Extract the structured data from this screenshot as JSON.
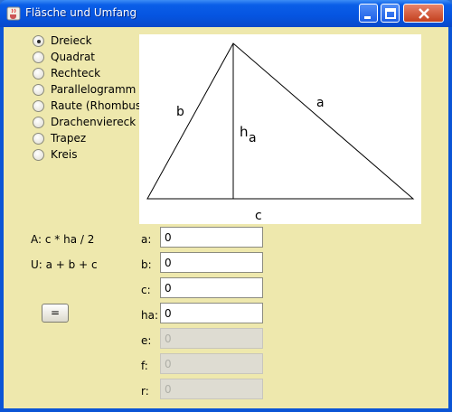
{
  "window": {
    "title": "Fläsche und Umfang"
  },
  "shapes": [
    {
      "label": "Dreieck",
      "selected": true
    },
    {
      "label": "Quadrat",
      "selected": false
    },
    {
      "label": "Rechteck",
      "selected": false
    },
    {
      "label": "Parallelogramm",
      "selected": false
    },
    {
      "label": "Raute (Rhombus)",
      "selected": false
    },
    {
      "label": "Drachenviereck",
      "selected": false
    },
    {
      "label": "Trapez",
      "selected": false
    },
    {
      "label": "Kreis",
      "selected": false
    }
  ],
  "diagram": {
    "label_a": "a",
    "label_b": "b",
    "label_c": "c",
    "label_h": "h",
    "label_h_sub": "a"
  },
  "formulas": {
    "area": "A: c * ha / 2",
    "perimeter": "U: a + b + c"
  },
  "calc_button": "=",
  "fields": [
    {
      "label": "a:",
      "value": "0",
      "enabled": true
    },
    {
      "label": "b:",
      "value": "0",
      "enabled": true
    },
    {
      "label": "c:",
      "value": "0",
      "enabled": true
    },
    {
      "label": "ha:",
      "value": "0",
      "enabled": true
    },
    {
      "label": "e:",
      "value": "0",
      "enabled": false
    },
    {
      "label": "f:",
      "value": "0",
      "enabled": false
    },
    {
      "label": "r:",
      "value": "0",
      "enabled": false
    }
  ],
  "colors": {
    "panel_bg": "#eee8ad",
    "titlebar": "#0554e0",
    "close_button": "#c3401e"
  }
}
